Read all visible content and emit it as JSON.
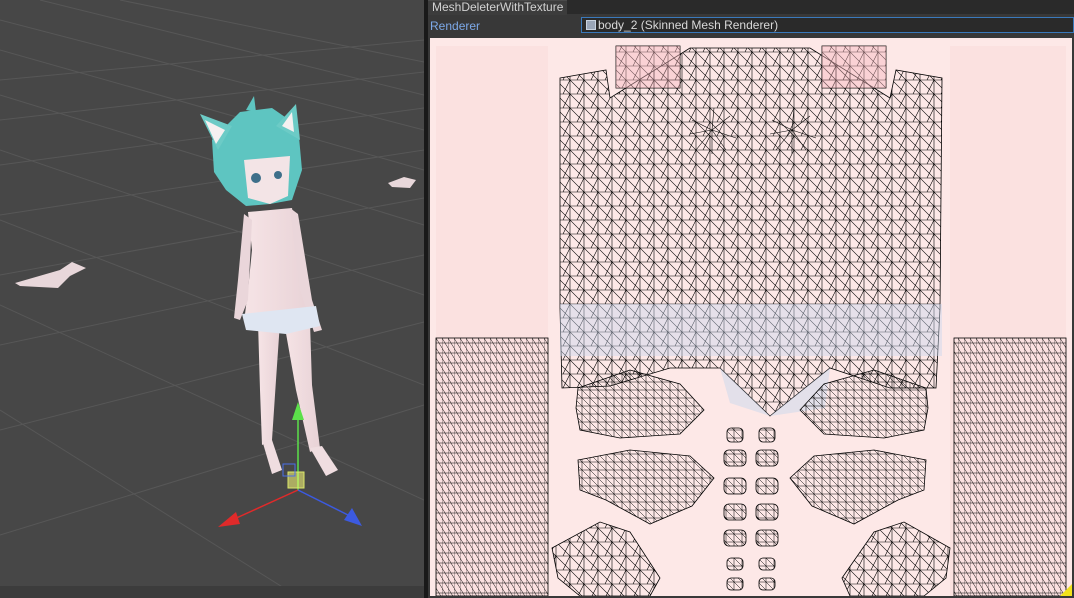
{
  "window": {
    "tab_title": "MeshDeleterWithTexture"
  },
  "renderer": {
    "label": "Renderer",
    "value": "body_2 (Skinned Mesh Renderer)",
    "icon": "skinned-mesh-renderer-icon"
  },
  "scene": {
    "gizmo_axes": [
      "x-axis-red",
      "y-axis-green",
      "z-axis-blue"
    ],
    "character": "avatar-cat-ear-girl"
  },
  "uv_view": {
    "texture": "body-texture-with-uv-wireframe",
    "wire_color": "#000000",
    "texture_color": "#fde8e7",
    "highlight_color": "#c9d8ee"
  },
  "colors": {
    "scene_bg": "#474747",
    "panel_bg": "#383838",
    "accent_label": "#7da9e8",
    "field_border": "#3a79bb"
  }
}
